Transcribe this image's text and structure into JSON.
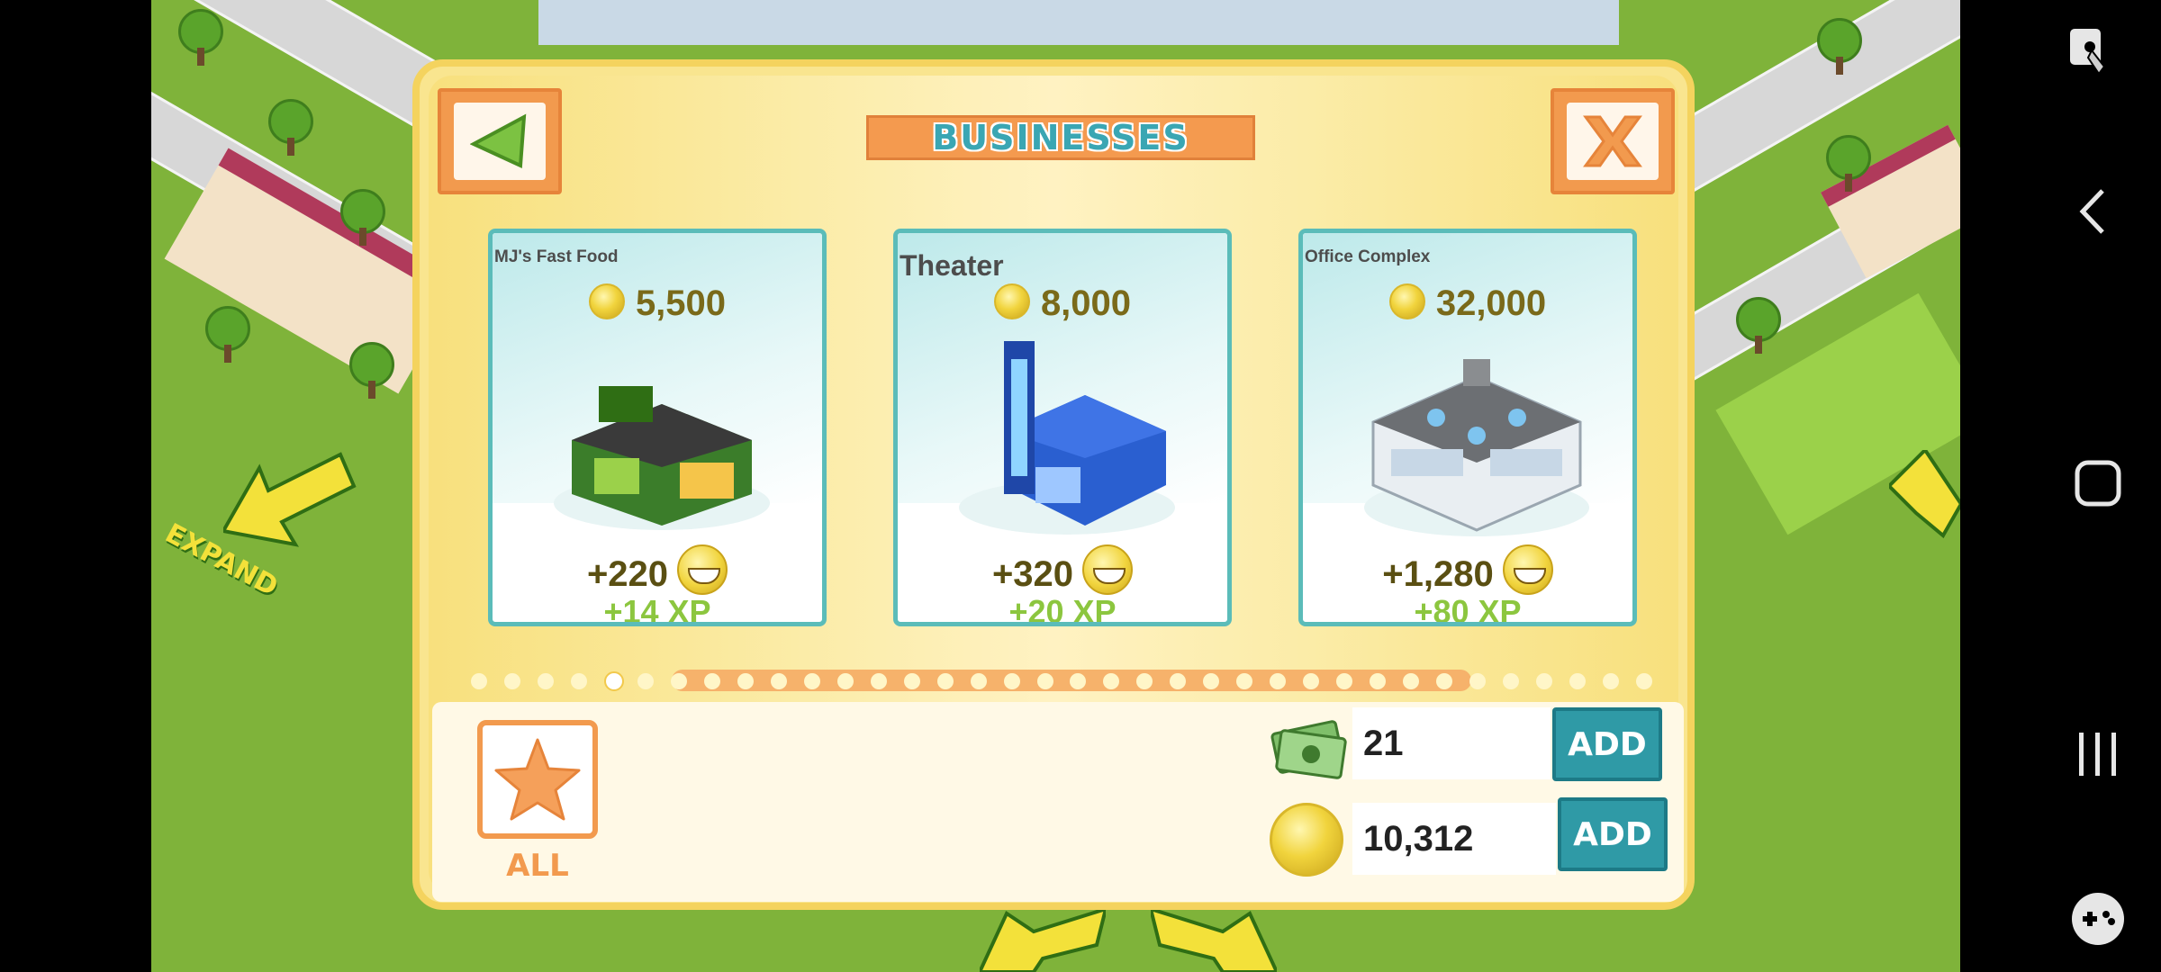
{
  "panel": {
    "title": "BUSINESSES",
    "back_icon": "triangle-left-icon",
    "close_icon": "x-close-icon"
  },
  "cards": [
    {
      "name": "MJ's Fast Food",
      "price": "5,500",
      "happiness": "+220",
      "xp": "+14 XP",
      "building_color": "#3b7d2a"
    },
    {
      "name": "Theater",
      "price": "8,000",
      "happiness": "+320",
      "xp": "+20 XP",
      "building_color": "#2a5fd0"
    },
    {
      "name": "Office Complex",
      "price": "32,000",
      "happiness": "+1,280",
      "xp": "+80 XP",
      "building_color": "#e9eef2"
    }
  ],
  "pager": {
    "active_index": 4,
    "total": 36
  },
  "filter": {
    "all_label": "ALL",
    "icon": "star-icon"
  },
  "wallet": {
    "cash": "21",
    "coins": "10,312",
    "add_cash_label": "ADD",
    "add_coins_label": "ADD"
  },
  "world": {
    "expand_label": "EXPAND"
  },
  "colors": {
    "panel_bg": "#f9e58f",
    "accent_orange": "#f29a4e",
    "accent_teal": "#2f9aa6",
    "xp_green": "#8cc63f"
  }
}
